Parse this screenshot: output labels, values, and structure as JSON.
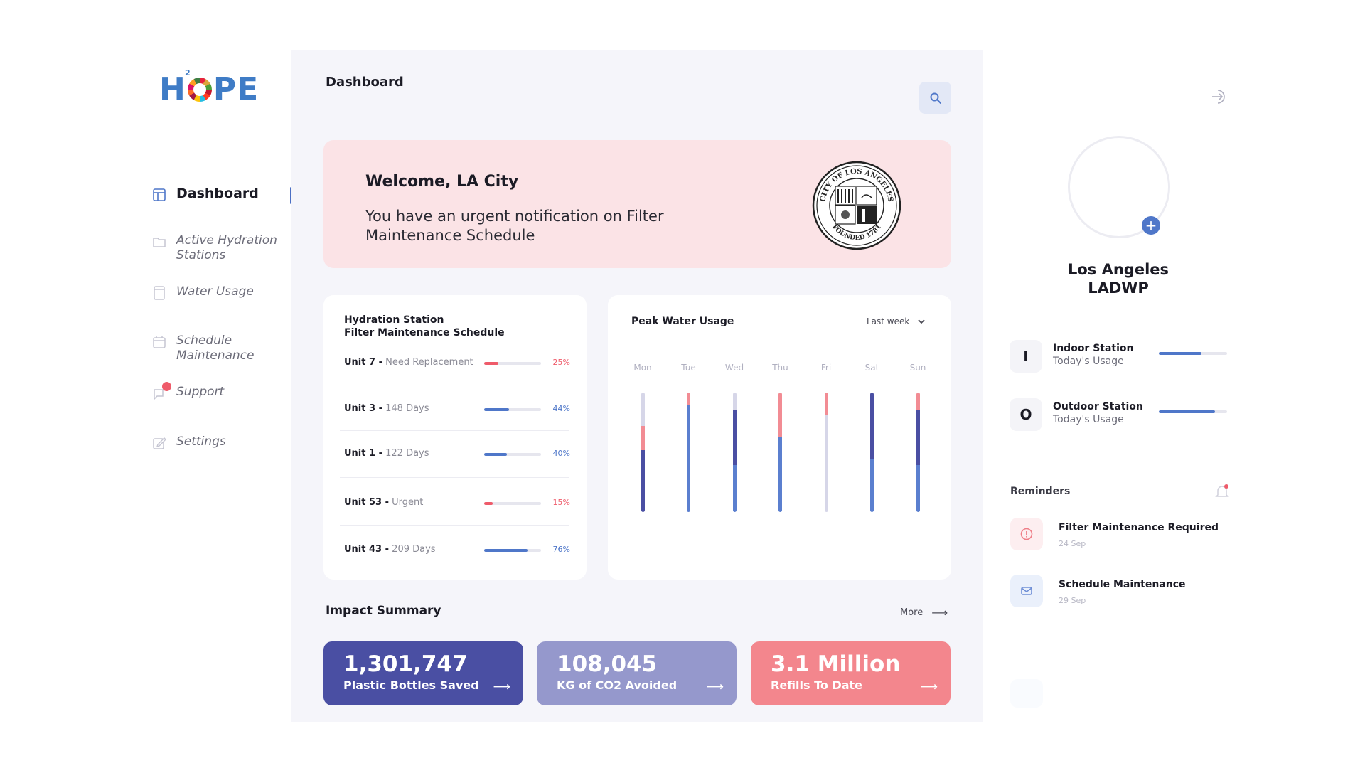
{
  "logo": {
    "text_h": "H",
    "text_rest": "PE",
    "superscript": "2"
  },
  "sidebar": {
    "items": [
      {
        "label": "Dashboard",
        "icon": "layout-icon",
        "active": true
      },
      {
        "label": "Active Hydration Stations",
        "icon": "folder-icon"
      },
      {
        "label": "Water Usage",
        "icon": "document-icon"
      },
      {
        "label": "Schedule Maintenance",
        "icon": "calendar-icon"
      },
      {
        "label": "Support",
        "icon": "chat-icon",
        "has_badge": true
      },
      {
        "label": "Settings",
        "icon": "edit-icon"
      }
    ]
  },
  "header": {
    "title": "Dashboard",
    "search_icon": "search-icon"
  },
  "banner": {
    "title": "Welcome, LA City",
    "message": "You have an urgent notification on Filter Maintenance Schedule",
    "seal_top_text": "CITY OF LOS ANGELES",
    "seal_bottom_text": "FOUNDED 1781"
  },
  "maintenance": {
    "title_line1": "Hydration Station",
    "title_line2": "Filter Maintenance Schedule",
    "rows": [
      {
        "unit": "Unit 7 -",
        "status": "Need Replacement",
        "percent": 25,
        "percent_label": "25%",
        "color": "#ef5b6a"
      },
      {
        "unit": "Unit 3 -",
        "status": "148 Days",
        "percent": 44,
        "percent_label": "44%",
        "color": "#4f77c9"
      },
      {
        "unit": "Unit 1 -",
        "status": "122 Days",
        "percent": 40,
        "percent_label": "40%",
        "color": "#4f77c9"
      },
      {
        "unit": "Unit 53 -",
        "status": "Urgent",
        "percent": 15,
        "percent_label": "15%",
        "color": "#ef5b6a"
      },
      {
        "unit": "Unit 43 -",
        "status": "209 Days",
        "percent": 76,
        "percent_label": "76%",
        "color": "#4f77c9"
      }
    ]
  },
  "peak_usage": {
    "title": "Peak Water Usage",
    "range_selected": "Last week"
  },
  "chart_data": {
    "type": "bar",
    "title": "Peak Water Usage",
    "stacked": true,
    "categories": [
      "Mon",
      "Tue",
      "Wed",
      "Thu",
      "Fri",
      "Sat",
      "Sun"
    ],
    "note": "Each day shows a full-height stacked column; segment values are fractions of the column, bottom to top",
    "bars": [
      {
        "day": "Mon",
        "segments": [
          {
            "color": "#4a4fa3",
            "value": 0.52
          },
          {
            "color": "#f28c94",
            "value": 0.2
          },
          {
            "color": "#d6d6e8",
            "value": 0.28
          }
        ]
      },
      {
        "day": "Tue",
        "segments": [
          {
            "color": "#5b7fcf",
            "value": 0.89
          },
          {
            "color": "#f28c94",
            "value": 0.11
          }
        ]
      },
      {
        "day": "Wed",
        "segments": [
          {
            "color": "#5b7fcf",
            "value": 0.39
          },
          {
            "color": "#4a4fa3",
            "value": 0.47
          },
          {
            "color": "#d6d6e8",
            "value": 0.14
          }
        ]
      },
      {
        "day": "Thu",
        "segments": [
          {
            "color": "#5b7fcf",
            "value": 0.63
          },
          {
            "color": "#f28c94",
            "value": 0.37
          }
        ]
      },
      {
        "day": "Fri",
        "segments": [
          {
            "color": "#d6d6e8",
            "value": 0.81
          },
          {
            "color": "#f28c94",
            "value": 0.19
          }
        ]
      },
      {
        "day": "Sat",
        "segments": [
          {
            "color": "#5b7fcf",
            "value": 0.44
          },
          {
            "color": "#4a4fa3",
            "value": 0.56
          }
        ]
      },
      {
        "day": "Sun",
        "segments": [
          {
            "color": "#5b7fcf",
            "value": 0.39
          },
          {
            "color": "#4a4fa3",
            "value": 0.47
          },
          {
            "color": "#f28c94",
            "value": 0.14
          }
        ]
      }
    ],
    "xlabel": "",
    "ylabel": ""
  },
  "impact": {
    "title": "Impact Summary",
    "more_label": "More",
    "stats": [
      {
        "value": "1,301,747",
        "label": "Plastic Bottles Saved",
        "color": "#4a4fa3"
      },
      {
        "value": "108,045",
        "label": "KG of CO2 Avoided",
        "color": "#9598cc"
      },
      {
        "value": "3.1 Million",
        "label": "Refills To Date",
        "color": "#f3868d"
      }
    ]
  },
  "profile": {
    "name_line1": "Los Angeles",
    "name_line2": "LADWP"
  },
  "stations": [
    {
      "letter": "I",
      "name": "Indoor Station",
      "sub": "Today's Usage",
      "usage_percent": 63
    },
    {
      "letter": "O",
      "name": "Outdoor Station",
      "sub": "Today's Usage",
      "usage_percent": 82
    }
  ],
  "reminders": {
    "title": "Reminders",
    "items": [
      {
        "title": "Filter Maintenance Required",
        "date": "24 Sep",
        "icon": "alert-icon"
      },
      {
        "title": "Schedule Maintenance",
        "date": "29 Sep",
        "icon": "mail-icon"
      }
    ]
  },
  "colors": {
    "accent": "#4f77c9",
    "navy": "#4a4fa3",
    "lavender": "#9598cc",
    "coral": "#f3868d",
    "banner_bg": "#fbe3e6",
    "panel_bg": "#f5f5fa"
  }
}
